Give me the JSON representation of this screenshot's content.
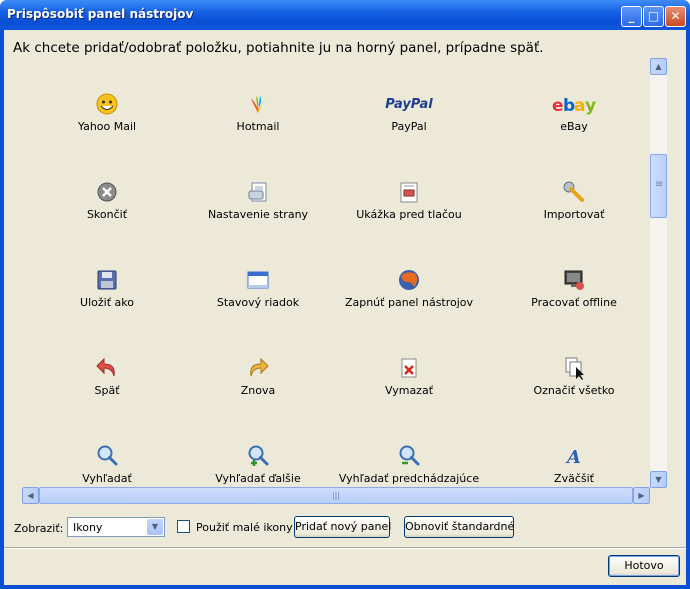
{
  "window": {
    "title": "Prispôsobiť panel nástrojov"
  },
  "title_buttons": {
    "minimize": "_",
    "maximize": "□",
    "close": "✕"
  },
  "instruction": "Ak chcete pridať/odobrať položku, potiahnite ju na horný panel, prípadne späť.",
  "items": [
    {
      "label": "Yahoo Mail",
      "icon": "yahoo-mail-icon"
    },
    {
      "label": "Hotmail",
      "icon": "hotmail-icon"
    },
    {
      "label": "PayPal",
      "icon": "paypal-icon"
    },
    {
      "label": "eBay",
      "icon": "ebay-icon"
    },
    {
      "label": "Skončiť",
      "icon": "exit-icon"
    },
    {
      "label": "Nastavenie strany",
      "icon": "page-setup-icon"
    },
    {
      "label": "Ukážka pred tlačou",
      "icon": "print-preview-icon"
    },
    {
      "label": "Importovať",
      "icon": "import-wrench-icon"
    },
    {
      "label": "Uložiť ako",
      "icon": "save-as-icon"
    },
    {
      "label": "Stavový riadok",
      "icon": "status-bar-icon"
    },
    {
      "label": "Zapnúť panel nástrojov",
      "icon": "toolbar-toggle-icon"
    },
    {
      "label": "Pracovať offline",
      "icon": "work-offline-icon"
    },
    {
      "label": "Späť",
      "icon": "undo-icon"
    },
    {
      "label": "Znova",
      "icon": "redo-icon"
    },
    {
      "label": "Vymazať",
      "icon": "delete-icon"
    },
    {
      "label": "Označiť všetko",
      "icon": "select-all-icon"
    },
    {
      "label": "Vyhľadať",
      "icon": "find-icon"
    },
    {
      "label": "Vyhľadať ďalšie",
      "icon": "find-next-icon"
    },
    {
      "label": "Vyhľadať predchádzajúce",
      "icon": "find-previous-icon"
    },
    {
      "label": "Zväčšiť",
      "icon": "zoom-in-text-icon"
    }
  ],
  "icon_text": {
    "paypal": "PayPal",
    "ebay_e": "e",
    "ebay_b": "b",
    "ebay_a": "a",
    "ebay_y": "y",
    "zoom_a": "A"
  },
  "scrollbars": {
    "up": "▲",
    "down": "▼",
    "left": "◀",
    "right": "▶",
    "v_grip": "≡",
    "h_grip": "|||"
  },
  "bottom": {
    "show_label": "Zobraziť:",
    "show_value": "Ikony",
    "dropdown_arrow": "▼",
    "small_icons_label": "Použiť malé ikony",
    "add_panel_button": "Pridať nový panel",
    "restore_default_button": "Obnoviť štandardné",
    "done_button": "Hotovo"
  },
  "colors": {
    "titlebar": "#0a4fd4",
    "client": "#ece9d8",
    "ebay_red": "#e53238",
    "ebay_blue": "#0064d2",
    "ebay_yellow": "#f5af02",
    "ebay_green": "#86b817",
    "paypal_blue": "#1d3f8f"
  }
}
